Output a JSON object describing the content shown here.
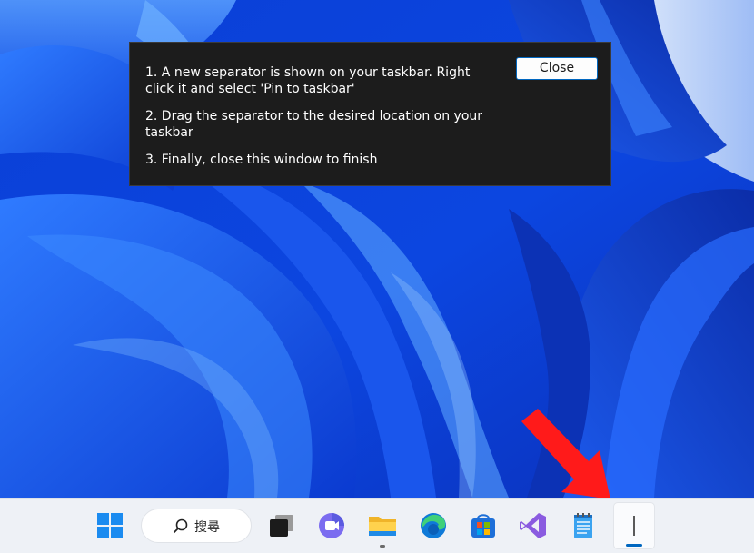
{
  "dialog": {
    "steps": [
      "1. A new separator is shown on your taskbar. Right click it and select 'Pin to taskbar'",
      "2. Drag the separator to the desired location on your taskbar",
      "3. Finally, close this window to finish"
    ],
    "close_label": "Close"
  },
  "taskbar": {
    "search_label": "搜尋",
    "items": [
      "start-icon",
      "search-icon",
      "task-view-icon",
      "teams-chat-icon",
      "file-explorer-icon",
      "edge-icon",
      "store-icon",
      "visual-studio-icon",
      "notepad-icon",
      "separator-icon"
    ]
  },
  "colors": {
    "accent": "#0067c0",
    "arrow": "#ff1a1a",
    "dialog_bg": "#1c1c1c",
    "taskbar_bg": "#eef1f6"
  }
}
